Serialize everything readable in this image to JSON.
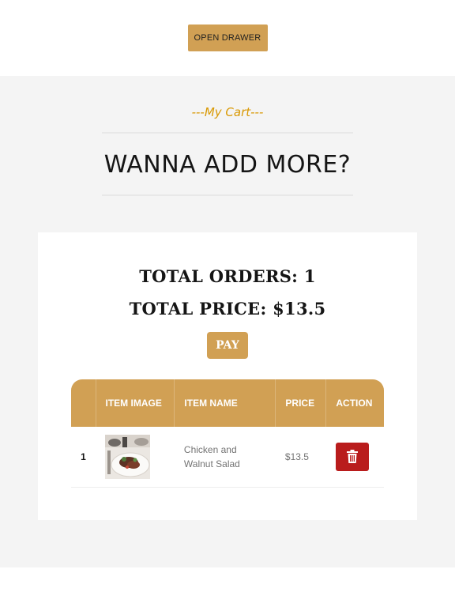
{
  "top_bar": {
    "open_drawer_label": "OPEN DRAWER"
  },
  "section": {
    "subheading": "---My Cart---",
    "heading": "WANNA ADD MORE?"
  },
  "summary": {
    "total_orders": "TOTAL ORDERS: 1",
    "total_price": "TOTAL PRICE: $13.5",
    "pay_label": "PAY"
  },
  "table": {
    "headers": [
      "",
      "ITEM IMAGE",
      "ITEM NAME",
      "PRICE",
      "ACTION"
    ],
    "rows": [
      {
        "index": "1",
        "name": "Chicken and Walnut Salad",
        "price": "$13.5"
      }
    ]
  },
  "colors": {
    "accent": "#d1a054",
    "subheading": "#d99904",
    "delete": "#b91c1c",
    "main_background": "#f4f4f4"
  },
  "icons": {
    "delete": "trash-icon",
    "item_image": "food-photo"
  }
}
